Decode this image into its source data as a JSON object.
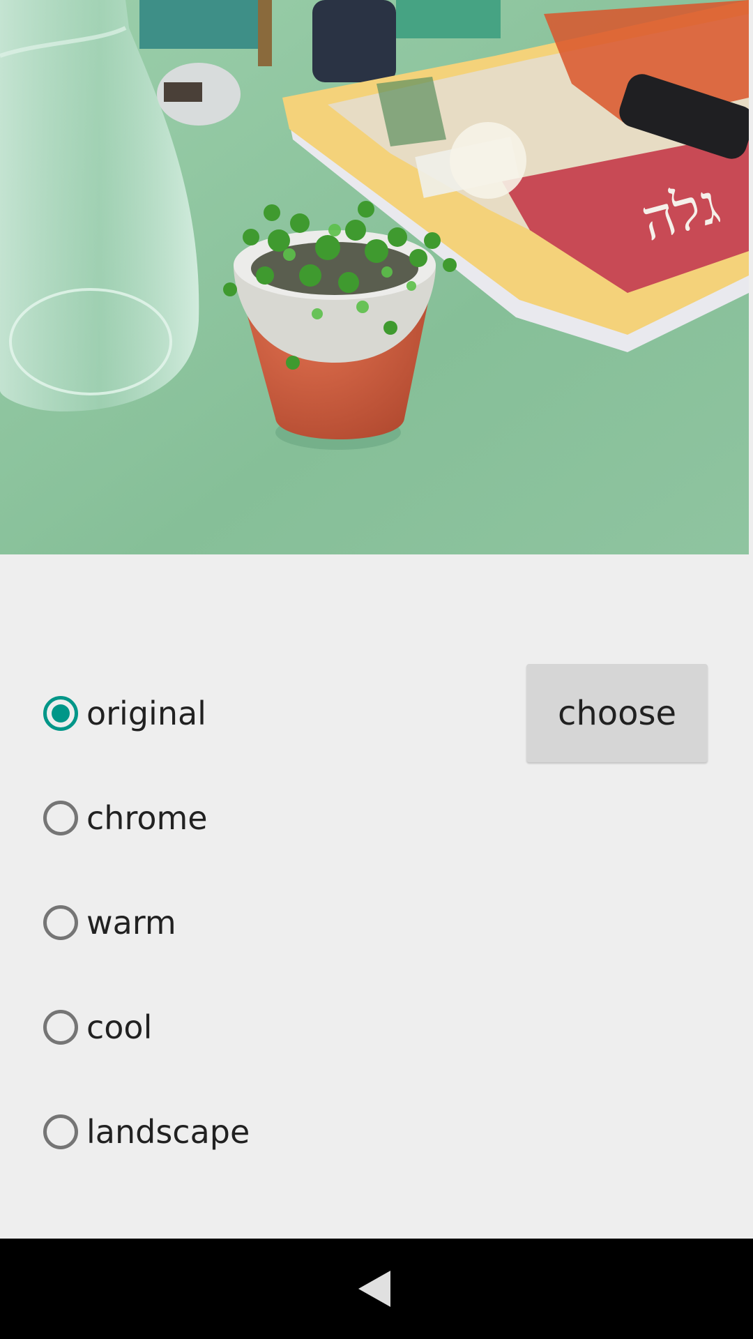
{
  "preview": {
    "description_icon": "photo-preview"
  },
  "filters": [
    {
      "label": "original",
      "checked": true
    },
    {
      "label": "chrome",
      "checked": false
    },
    {
      "label": "warm",
      "checked": false
    },
    {
      "label": "cool",
      "checked": false
    },
    {
      "label": "landscape",
      "checked": false
    }
  ],
  "choose_button": {
    "label": "choose"
  },
  "navigation": {
    "back_icon": "back-triangle-icon"
  },
  "colors": {
    "accent": "#009688",
    "background": "#eeeeee",
    "button": "#d6d6d6",
    "navbar": "#000000"
  }
}
